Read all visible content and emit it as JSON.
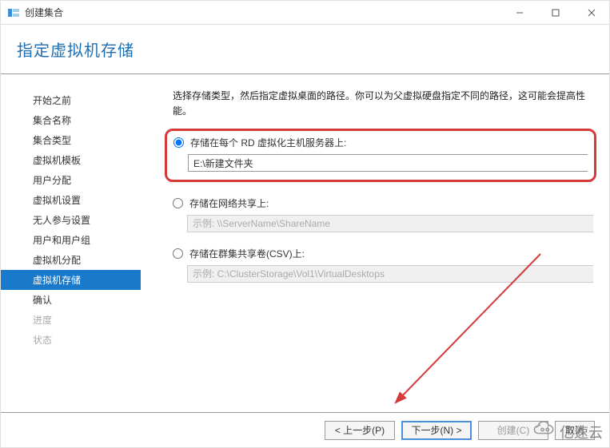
{
  "window": {
    "title": "创建集合"
  },
  "page": {
    "title": "指定虚拟机存储"
  },
  "sidebar": {
    "items": [
      {
        "label": "开始之前"
      },
      {
        "label": "集合名称"
      },
      {
        "label": "集合类型"
      },
      {
        "label": "虚拟机模板"
      },
      {
        "label": "用户分配"
      },
      {
        "label": "虚拟机设置"
      },
      {
        "label": "无人参与设置"
      },
      {
        "label": "用户和用户组"
      },
      {
        "label": "虚拟机分配"
      },
      {
        "label": "虚拟机存储"
      },
      {
        "label": "确认"
      },
      {
        "label": "进度"
      },
      {
        "label": "状态"
      }
    ]
  },
  "content": {
    "description": "选择存储类型，然后指定虚拟桌面的路径。你可以为父虚拟硬盘指定不同的路径，这可能会提高性能。",
    "option1": {
      "label": "存储在每个 RD 虚拟化主机服务器上:",
      "value": "E:\\新建文件夹"
    },
    "option2": {
      "label": "存储在网络共享上:",
      "placeholder": "示例: \\\\ServerName\\ShareName"
    },
    "option3": {
      "label": "存储在群集共享卷(CSV)上:",
      "placeholder": "示例: C:\\ClusterStorage\\Vol1\\VirtualDesktops"
    }
  },
  "footer": {
    "prev": "< 上一步(P)",
    "next": "下一步(N) >",
    "create": "创建(C)",
    "cancel": "取消"
  },
  "watermark": "亿速云"
}
